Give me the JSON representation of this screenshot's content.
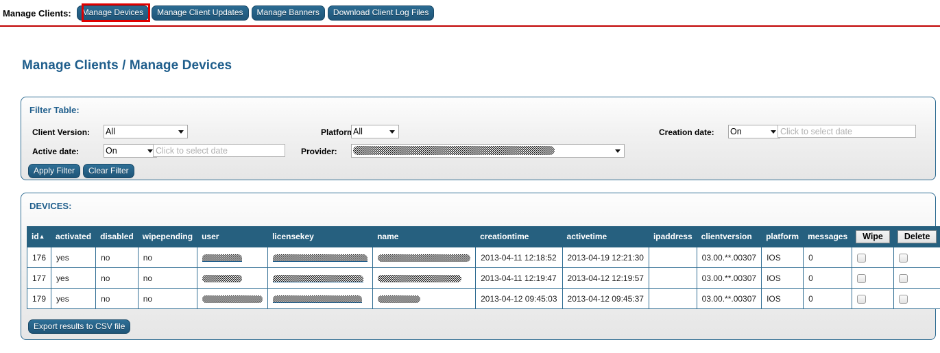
{
  "topbar": {
    "label": "Manage Clients:",
    "buttons": [
      {
        "label": "Manage Devices",
        "active": true
      },
      {
        "label": "Manage Client Updates",
        "active": false
      },
      {
        "label": "Manage Banners",
        "active": false
      },
      {
        "label": "Download Client Log Files",
        "active": false
      }
    ]
  },
  "page": {
    "title": "Manage Clients / Manage Devices"
  },
  "filter": {
    "title": "Filter Table:",
    "client_version": {
      "label": "Client Version:",
      "value": "All",
      "options": [
        "All"
      ]
    },
    "active_date": {
      "label": "Active date:",
      "mode": "On",
      "mode_options": [
        "On"
      ],
      "placeholder": "Click to select date",
      "value": ""
    },
    "platform": {
      "label": "Platform:",
      "value": "All",
      "options": [
        "All"
      ]
    },
    "provider": {
      "label": "Provider:",
      "value": "",
      "redacted": true
    },
    "creation_date": {
      "label": "Creation date:",
      "mode": "On",
      "mode_options": [
        "On"
      ],
      "placeholder": "Click to select date",
      "value": ""
    },
    "apply_label": "Apply Filter",
    "clear_label": "Clear Filter"
  },
  "devices": {
    "title": "DEVICES:",
    "sort_column": "id",
    "sort_direction": "asc",
    "sort_arrow": "▲",
    "columns": [
      "id",
      "activated",
      "disabled",
      "wipepending",
      "user",
      "licensekey",
      "name",
      "creationtime",
      "activetime",
      "ipaddress",
      "clientversion",
      "platform",
      "messages"
    ],
    "wipe_label": "Wipe",
    "delete_label": "Delete",
    "rows": [
      {
        "id": "176",
        "activated": "yes",
        "disabled": "no",
        "wipepending": "no",
        "user": "[redacted]",
        "licensekey": "[redacted]",
        "name": "[redacted]",
        "creationtime": "2013-04-11 12:18:52",
        "activetime": "2013-04-19 12:21:30",
        "ipaddress": "",
        "clientversion": "03.00.**.00307",
        "platform": "IOS",
        "messages": "0",
        "wipe_checked": false,
        "delete_checked": false
      },
      {
        "id": "177",
        "activated": "yes",
        "disabled": "no",
        "wipepending": "no",
        "user": "[redacted]",
        "licensekey": "[redacted]",
        "name": "[redacted]",
        "creationtime": "2013-04-11 12:19:47",
        "activetime": "2013-04-12 12:19:57",
        "ipaddress": "",
        "clientversion": "03.00.**.00307",
        "platform": "IOS",
        "messages": "0",
        "wipe_checked": false,
        "delete_checked": false
      },
      {
        "id": "179",
        "activated": "yes",
        "disabled": "no",
        "wipepending": "no",
        "user": "[redacted]",
        "licensekey": "[redacted]",
        "name": "[redacted]",
        "creationtime": "2013-04-12 09:45:03",
        "activetime": "2013-04-12 09:45:37",
        "ipaddress": "",
        "clientversion": "03.00.**.00307",
        "platform": "IOS",
        "messages": "0",
        "wipe_checked": false,
        "delete_checked": false
      }
    ],
    "export_label": "Export results to CSV file"
  },
  "colors": {
    "brand_blue": "#1f5e8c",
    "table_header": "#26607f",
    "button_blue": "#245f84",
    "highlight_red": "#e00000"
  },
  "_redaction_widths": {
    "user": [
      58,
      58,
      88
    ],
    "licensekey": [
      138,
      132,
      130
    ],
    "name": [
      135,
      122,
      62
    ]
  }
}
